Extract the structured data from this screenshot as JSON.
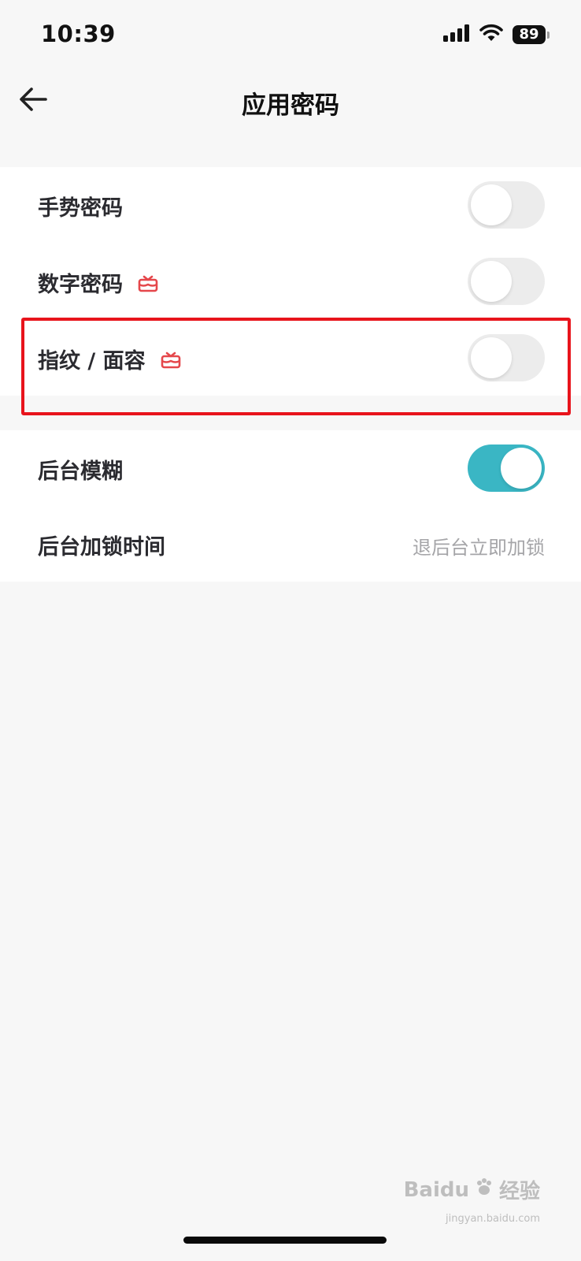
{
  "status_bar": {
    "time": "10:39",
    "battery": "89"
  },
  "header": {
    "title": "应用密码",
    "back_icon": "arrow-left-icon"
  },
  "group_1": {
    "items": [
      {
        "label": "手势密码",
        "toggle_on": false,
        "vip": false
      },
      {
        "label": "数字密码",
        "toggle_on": false,
        "vip": true
      },
      {
        "label": "指纹 / 面容",
        "toggle_on": false,
        "vip": true
      }
    ]
  },
  "group_2": {
    "items": [
      {
        "label": "后台模糊",
        "toggle_on": true
      },
      {
        "label": "后台加锁时间",
        "value": "退后台立即加锁"
      }
    ]
  },
  "colors": {
    "accent": "#3ab6c4",
    "vip_icon": "#e5474b",
    "highlight": "#e8141c",
    "background": "#f7f7f7"
  },
  "watermark": {
    "brand": "Baidu",
    "suffix": "经验",
    "url": "jingyan.baidu.com"
  }
}
